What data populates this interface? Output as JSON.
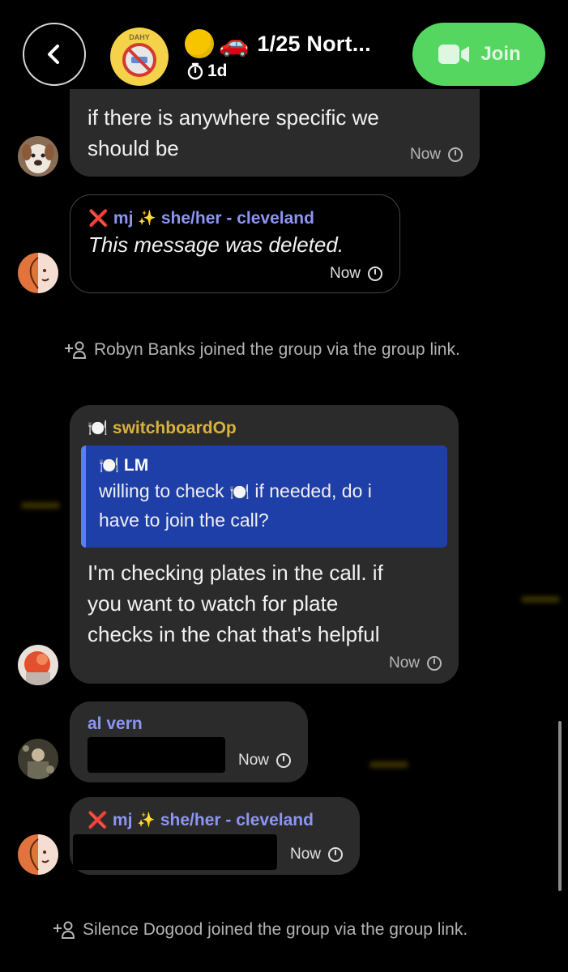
{
  "header": {
    "title": "1/25 Nort...",
    "disappearing_timer": "1d",
    "join_label": "Join",
    "car_emoji": "🚗",
    "group_avatar_text": "DAHY"
  },
  "messages": [
    {
      "text_line1": "if there is anywhere specific we",
      "text_line2": "should be",
      "time": "Now"
    },
    {
      "sender_mark": "❌",
      "sender_name": "mj",
      "sender_sparkle": "✨",
      "sender_suffix": "she/her - cleveland",
      "text": "This message was deleted.",
      "time": "Now"
    },
    {
      "sender_mark": "🍽️",
      "sender_name": "switchboardOp",
      "quote_author_mark": "🍽️",
      "quote_author": "LM",
      "quote_line1_a": "willing to check",
      "quote_line1_emoji": "🍽️",
      "quote_line1_b": "if needed, do i",
      "quote_line2": "have to join the call?",
      "text_line1": "I'm checking plates in the call. if",
      "text_line2": "you want to watch for plate",
      "text_line3": "checks in the chat that's helpful",
      "time": "Now"
    },
    {
      "sender_name": "al vern",
      "time": "Now"
    },
    {
      "sender_mark": "❌",
      "sender_name": "mj",
      "sender_sparkle": "✨",
      "sender_suffix": "she/her - cleveland",
      "time": "Now"
    }
  ],
  "system": {
    "join1": "Robyn Banks joined the group via the group link.",
    "join2": "Silence Dogood joined the group via the group link."
  },
  "colors": {
    "background": "#000000",
    "bubble": "#2b2b2b",
    "join_button": "#54d661",
    "sender_blue": "#8d95f4",
    "sender_gold": "#d8b23a",
    "quote": "#1f3fa8"
  }
}
